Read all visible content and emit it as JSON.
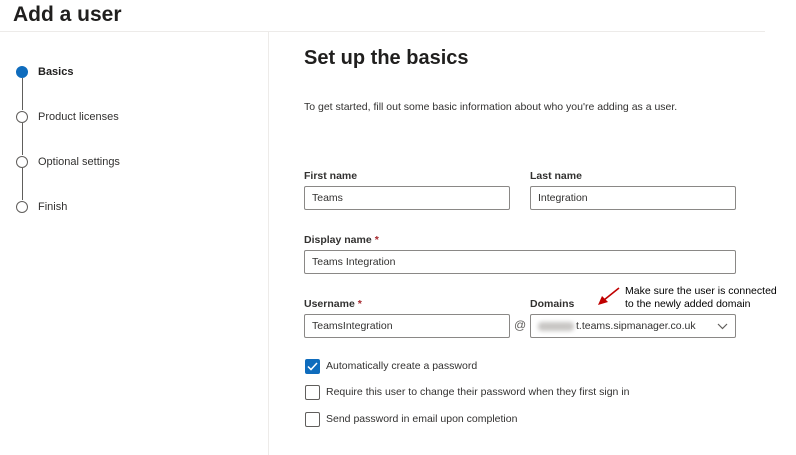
{
  "page": {
    "title": "Add a user"
  },
  "steps": [
    {
      "label": "Basics",
      "active": true
    },
    {
      "label": "Product licenses",
      "active": false
    },
    {
      "label": "Optional settings",
      "active": false
    },
    {
      "label": "Finish",
      "active": false
    }
  ],
  "main": {
    "title": "Set up the basics",
    "intro": "To get started, fill out some basic information about who you're adding as a user."
  },
  "form": {
    "first_name": {
      "label": "First name",
      "value": "Teams"
    },
    "last_name": {
      "label": "Last name",
      "value": "Integration"
    },
    "display_name": {
      "label": "Display name",
      "required_mark": "*",
      "value": "Teams Integration"
    },
    "username": {
      "label": "Username",
      "required_mark": "*",
      "value": "TeamsIntegration",
      "separator": "@"
    },
    "domains": {
      "label": "Domains",
      "value": "t.teams.sipmanager.co.uk"
    }
  },
  "annotation": {
    "line1": "Make sure the user is connected",
    "line2": "to the newly added domain",
    "color": "#c00000"
  },
  "options": [
    {
      "label": "Automatically create a password",
      "checked": true
    },
    {
      "label": "Require this user to change their password when they first sign in",
      "checked": false
    },
    {
      "label": "Send password in email upon completion",
      "checked": false
    }
  ],
  "colors": {
    "accent": "#0f6cbd",
    "required": "#a4262c"
  }
}
